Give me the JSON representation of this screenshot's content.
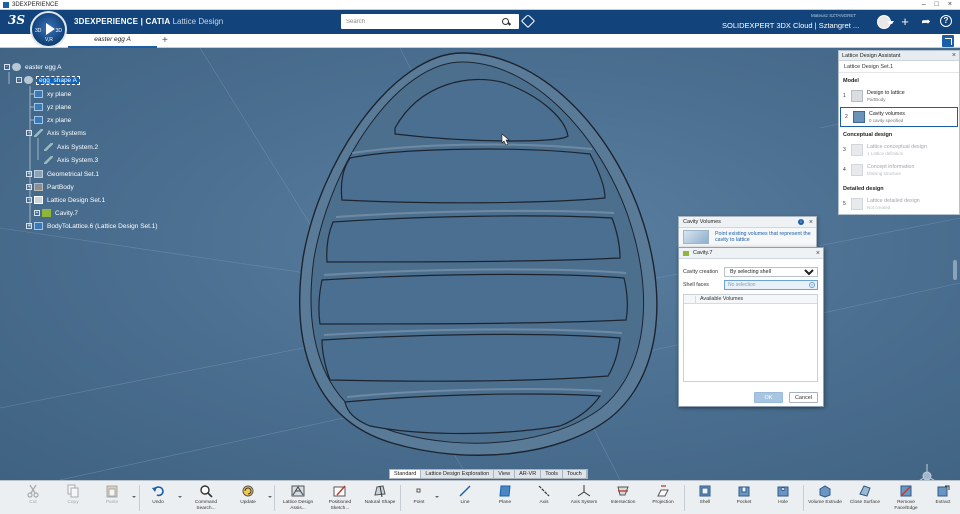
{
  "os": {
    "title": "3DEXPERIENCE"
  },
  "header": {
    "brand": "3DEXPERIENCE | CATIA",
    "app": "Lattice Design",
    "search_placeholder": "Search",
    "user": "Mateusz SZTANGRET",
    "platform": "SOLIDEXPERT 3DX Cloud | Sztangret ...",
    "compass_labels": {
      "v": "V,R",
      "l": "3D",
      "r": "3D"
    }
  },
  "tabs": {
    "doc": "easter egg A",
    "new": "+"
  },
  "tree": {
    "root": "easter egg A",
    "shape": "egg_shape A",
    "nodes": [
      "xy plane",
      "yz plane",
      "zx plane",
      "Axis Systems",
      "Axis System.2",
      "Axis System.3",
      "Geometrical Set.1",
      "PartBody",
      "Lattice Design Set.1",
      "Cavity.7",
      "BodyToLattice.6 (Lattice Design Set.1)"
    ]
  },
  "assistant": {
    "title": "Lattice Design Assistant",
    "set": "Lattice Design Set.1",
    "sections": {
      "model": "Model",
      "conceptual": "Conceptual design",
      "detailed": "Detailed design"
    },
    "steps": [
      {
        "num": "1",
        "title": "Design to lattice",
        "sub": "PartBody"
      },
      {
        "num": "2",
        "title": "Cavity volumes",
        "sub": "0 cavity specified"
      },
      {
        "num": "3",
        "title": "Lattice conceptual design",
        "sub": "1 Lattice definition"
      },
      {
        "num": "4",
        "title": "Concept information",
        "sub": "Missing structure"
      },
      {
        "num": "5",
        "title": "Lattice detailed design",
        "sub": "Not created"
      }
    ]
  },
  "cavity_volumes": {
    "title": "Cavity Volumes",
    "hint": "Point existing volumes that represent the cavity to lattice",
    "info": "i"
  },
  "cavity7": {
    "title": "Cavity.7",
    "creation_label": "Cavity creation",
    "creation_value": "By selecting shell",
    "shell_label": "Shell faces",
    "shell_value": "No selection",
    "list_header": "Available Volumes",
    "ok": "OK",
    "cancel": "Cancel"
  },
  "toolbar_tabs": [
    "Standard",
    "Lattice Design Exploration",
    "View",
    "AR-VR",
    "Tools",
    "Touch"
  ],
  "toolbar": [
    {
      "label": "Cut",
      "icon": "scissors-icon",
      "enabled": false
    },
    {
      "label": "Copy",
      "icon": "copy-icon",
      "enabled": false
    },
    {
      "label": "Paste",
      "icon": "paste-icon",
      "enabled": false
    },
    {
      "label": "Undo",
      "icon": "undo-icon",
      "enabled": true
    },
    {
      "label": "Command Search...",
      "icon": "command-search-icon",
      "enabled": true
    },
    {
      "label": "Update",
      "icon": "update-icon",
      "enabled": true
    },
    {
      "label": "Lattice Design Assis...",
      "icon": "lattice-assistant-icon",
      "enabled": true
    },
    {
      "label": "Positioned Sketch...",
      "icon": "sketch-icon",
      "enabled": true
    },
    {
      "label": "Natural Shape",
      "icon": "natural-shape-icon",
      "enabled": true
    },
    {
      "label": "Point",
      "icon": "point-icon",
      "enabled": true
    },
    {
      "label": "Line",
      "icon": "line-icon",
      "enabled": true
    },
    {
      "label": "Plane",
      "icon": "plane-icon",
      "enabled": true
    },
    {
      "label": "Axis",
      "icon": "axis-icon",
      "enabled": true
    },
    {
      "label": "Axis System",
      "icon": "axis-system-icon",
      "enabled": true
    },
    {
      "label": "Intersection",
      "icon": "intersection-icon",
      "enabled": true
    },
    {
      "label": "Projection",
      "icon": "projection-icon",
      "enabled": true
    },
    {
      "label": "Shell",
      "icon": "shell-icon",
      "enabled": true
    },
    {
      "label": "Pocket",
      "icon": "pocket-icon",
      "enabled": true
    },
    {
      "label": "Hole",
      "icon": "hole-icon",
      "enabled": true
    },
    {
      "label": "Volume Extrude",
      "icon": "volume-extrude-icon",
      "enabled": true
    },
    {
      "label": "Close Surface",
      "icon": "close-surface-icon",
      "enabled": true
    },
    {
      "label": "Remove Face/Edge",
      "icon": "remove-face-icon",
      "enabled": true
    },
    {
      "label": "Extract",
      "icon": "extract-icon",
      "enabled": true
    }
  ],
  "colors": {
    "header": "#12437a",
    "accent": "#1a5fa8",
    "viewport": "#4b6f90"
  }
}
